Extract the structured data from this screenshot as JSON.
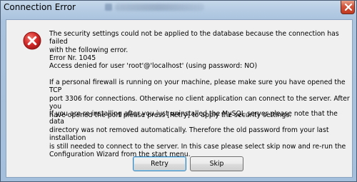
{
  "window": {
    "title": "Connection Error"
  },
  "dialog": {
    "icon": "error-icon",
    "paragraphs": [
      "The security settings could not be applied to the database because the connection has failed\nwith the following error.",
      "Error Nr. 1045\nAccess denied for user 'root'@'localhost' (using password: NO)",
      "If a personal firewall is running on your machine, please make sure you have opened the TCP\nport 3306 for connections. Otherwise no client application can connect to the server. After you\nhave opened the port please press [Retry] to apply the security settings.",
      "If you are re-installing after you just uninstalled the MySQL server please note that the data\ndirectory was not removed automatically. Therefore the old password from your last installation\nis still needed to connect to the server. In this case please select skip now and re-run the\nConfiguration Wizard from the start menu."
    ]
  },
  "buttons": {
    "retry": "Retry",
    "skip": "Skip"
  },
  "colors": {
    "frame": "#a9c2dd",
    "client_background": "#f0f0f0",
    "error_red": "#d42b2b",
    "close_button": "#c8442b"
  }
}
